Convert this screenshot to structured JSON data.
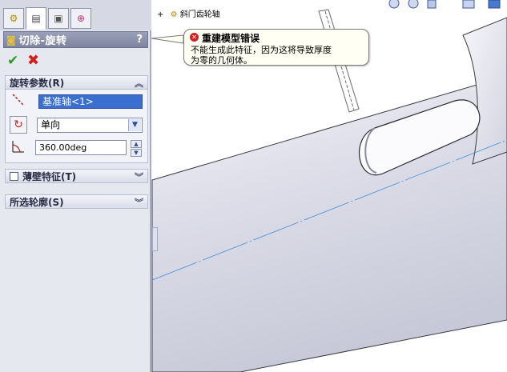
{
  "tree": {
    "expander": "+",
    "node_label": "斜门齿轮轴"
  },
  "panel": {
    "title": "切除-旋转",
    "help": "?",
    "ok_icon": "check-icon",
    "cancel_icon": "x-icon"
  },
  "revolve_params": {
    "header": "旋转参数(R)",
    "axis_value": "基准轴<1>",
    "direction_value": "单向",
    "angle_value": "360.00deg"
  },
  "thin_feature": {
    "header": "薄壁特征(T)",
    "checked": false
  },
  "selected_contours": {
    "header": "所选轮廓(S)"
  },
  "error_tooltip": {
    "title": "重建模型错误",
    "line1": "不能生成此特征，因为这将导致厚度",
    "line2": "为零的几何体。"
  },
  "colors": {
    "accent": "#3a6fd0",
    "error": "#d22020",
    "panel_bg": "#e6e8f0"
  }
}
